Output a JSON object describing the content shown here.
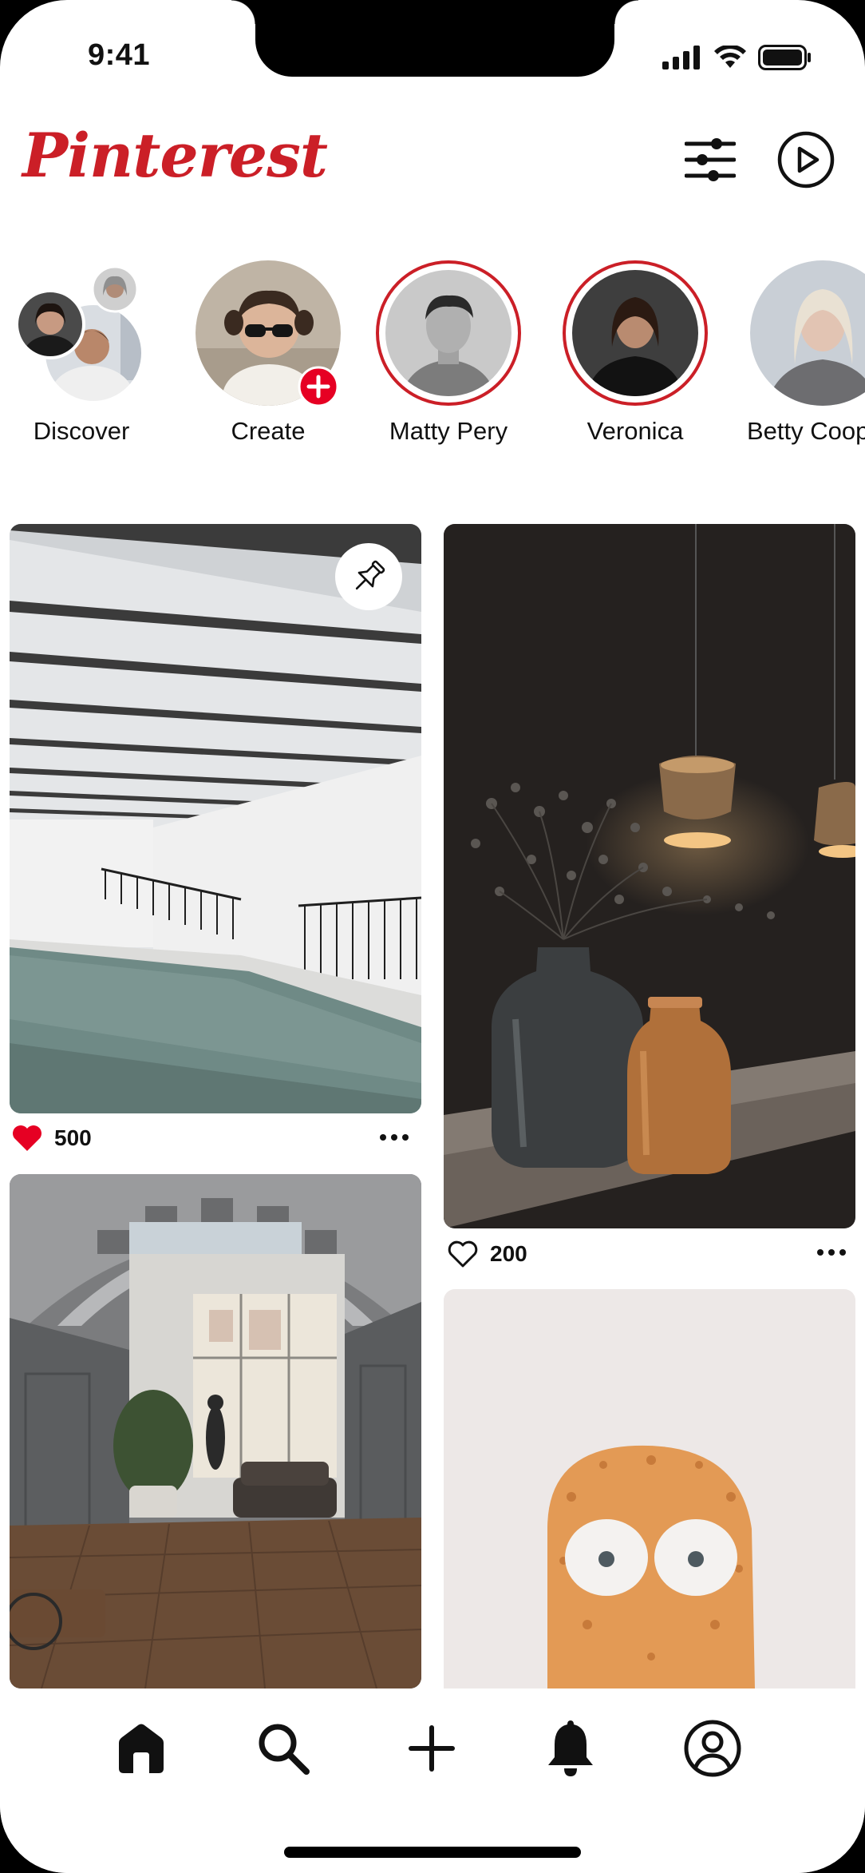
{
  "status_bar": {
    "time": "9:41"
  },
  "header": {
    "logo": "Pinterest",
    "filter_icon": "sliders-icon",
    "play_icon": "play-circle-icon"
  },
  "stories": [
    {
      "label": "Discover",
      "ring": false
    },
    {
      "label": "Create",
      "ring": false
    },
    {
      "label": "Matty Pery",
      "ring": true
    },
    {
      "label": "Veronica",
      "ring": true
    },
    {
      "label": "Betty Cooper",
      "ring": false
    }
  ],
  "pins": [
    {
      "title": "Indoor pool",
      "likes": "500",
      "liked": true,
      "saved_icon": "pin-icon"
    },
    {
      "title": "Vases with pendant lamps",
      "likes": "200",
      "liked": false
    },
    {
      "title": "Arched interior hall"
    },
    {
      "title": "Orange figure with eyes"
    }
  ],
  "bottom_nav": [
    "home-icon",
    "search-icon",
    "plus-icon",
    "bell-icon",
    "profile-icon"
  ],
  "colors": {
    "brand": "#CB1F27",
    "like": "#E60023",
    "text": "#111111"
  }
}
